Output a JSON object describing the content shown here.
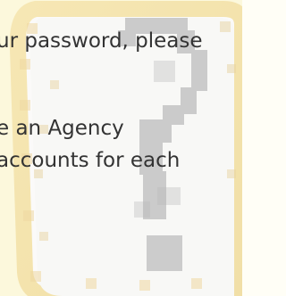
{
  "help_panel": {
    "lines": [
      "ur password, please",
      "e an Agency",
      "accounts for each"
    ],
    "graphic_icon": "question-mark-icon"
  },
  "colors": {
    "background": "#fdfbe2",
    "panel_fill": "#f8f8f6",
    "panel_border": "#ead9a8",
    "question_mark": "#c9c9c9",
    "text": "#333333"
  }
}
